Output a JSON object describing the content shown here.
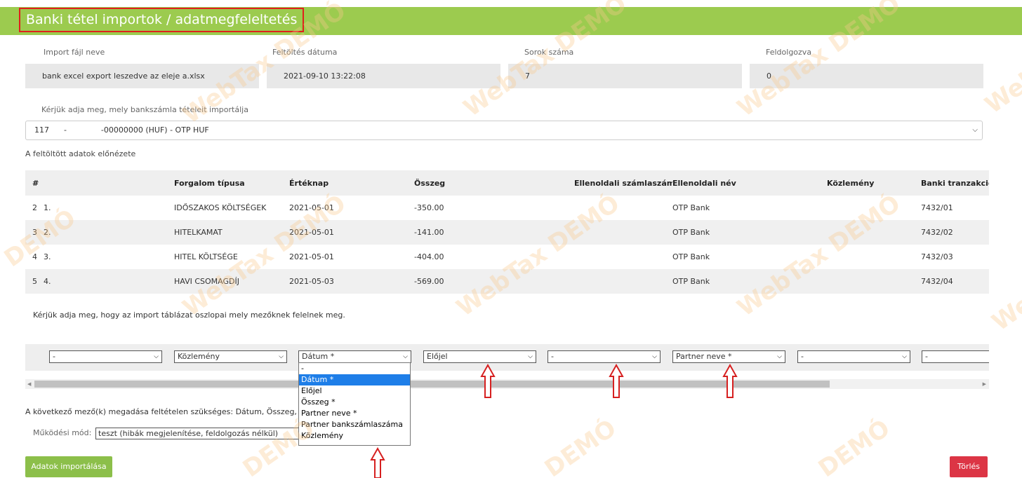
{
  "header": {
    "title": "Banki tétel importok / adatmegfeleltetés"
  },
  "info": {
    "file_label": "Import fájl neve",
    "file_value": "bank excel export leszedve az eleje a.xlsx",
    "date_label": "Feltöltés dátuma",
    "date_value": "2021-09-10 13:22:08",
    "rows_label": "Sorok száma",
    "rows_value": "7",
    "processed_label": "Feldolgozva",
    "processed_value": "0"
  },
  "account": {
    "prompt": "Kérjük adja meg, mely bankszámla tételeit importálja",
    "selected": "117      -              -00000000 (HUF) - OTP HUF"
  },
  "preview": {
    "title": "A feltöltött adatok előnézete",
    "columns": [
      "#",
      "",
      "Forgalom típusa",
      "Értéknap",
      "Összeg",
      "Ellenoldali számlaszám",
      "Ellenoldali név",
      "Közlemény",
      "Banki tranzakció"
    ],
    "rows": [
      [
        "2",
        "1.",
        "IDŐSZAKOS KÖLTSÉGEK",
        "2021-05-01",
        "-350.00",
        "",
        "OTP Bank",
        "",
        "7432/01"
      ],
      [
        "3",
        "2.",
        "HITELKAMAT",
        "2021-05-01",
        "-141.00",
        "",
        "OTP Bank",
        "",
        "7432/02"
      ],
      [
        "4",
        "3.",
        "HITEL KÖLTSÉGE",
        "2021-05-01",
        "-404.00",
        "",
        "OTP Bank",
        "",
        "7432/03"
      ],
      [
        "5",
        "4.",
        "HAVI CSOMAGDÍJ",
        "2021-05-03",
        "-569.00",
        "",
        "OTP Bank",
        "",
        "7432/04"
      ]
    ]
  },
  "mapping": {
    "prompt": "Kérjük adja meg, hogy az import táblázat oszlopai mely mezőknek felelnek meg.",
    "selects": [
      "-",
      "Közlemény",
      "Dátum *",
      "Előjel",
      "-",
      "Partner neve *",
      "-",
      "-"
    ],
    "dropdown_options": [
      "-",
      "Dátum *",
      "Előjel",
      "Összeg *",
      "Partner neve *",
      "Partner bankszámlaszáma",
      "Közlemény"
    ],
    "dropdown_selected": "Dátum *"
  },
  "required_note": "A következő mező(k) megadása feltételen szükséges: Dátum, Összeg, Partn",
  "mode": {
    "label": "Működési mód:",
    "value": "teszt (hibák megjelenítése, feldolgozás nélkül)"
  },
  "buttons": {
    "import": "Adatok importálása",
    "delete": "Törlés"
  },
  "watermarks": [
    "WebTax DEMÓ",
    "DEMÓ",
    "Web"
  ],
  "colors": {
    "header_green": "#9ccb4f",
    "highlight_red": "#e0201c",
    "import_green": "#8cbf4a",
    "delete_red": "#dc3545",
    "selected_option_blue": "#1e7ee8"
  }
}
